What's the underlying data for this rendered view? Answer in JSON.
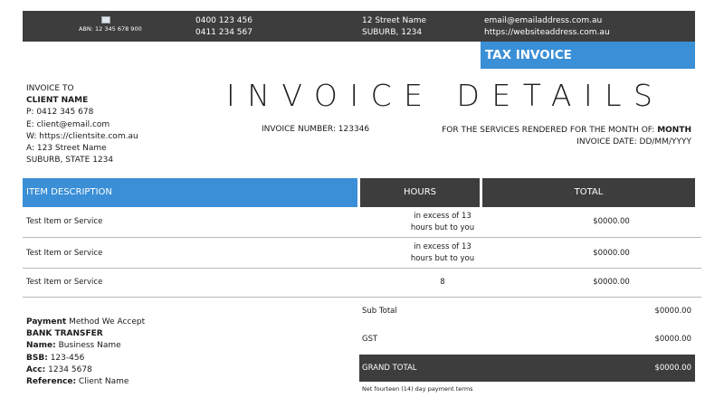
{
  "header": {
    "abn": "ABN: 12 345 678 900",
    "phones": [
      "0400 123 456",
      "0411 234 567"
    ],
    "address": [
      "12 Street Name",
      "SUBURB, 1234"
    ],
    "contact": [
      "email@emailaddress.com.au",
      "https://websiteaddress.com.au"
    ],
    "colors": {
      "dark": "#3d3d3d",
      "accent": "#3a8fd6"
    }
  },
  "badge": "TAX INVOICE",
  "client": {
    "heading": "INVOICE TO",
    "name": "CLIENT NAME",
    "phone": "P: 0412 345 678",
    "email": "E: client@email.com",
    "web": "W: https://clientsite.com.au",
    "address1": "A: 123 Street Name",
    "address2": "SUBURB, STATE 1234"
  },
  "title": "INVOICE DETAILS",
  "invoice_number": "INVOICE NUMBER: 123346",
  "services": {
    "prefix": "FOR THE SERVICES RENDERED FOR THE MONTH OF:",
    "month": "MONTH",
    "date": "INVOICE DATE: DD/MM/YYYY"
  },
  "table": {
    "headers": {
      "desc": "ITEM DESCRIPTION",
      "hours": "HOURS",
      "total": "TOTAL"
    },
    "rows": [
      {
        "desc": "Test Item or Service",
        "hours_line1": "in excess of 13",
        "hours_line2": "hours but to you",
        "total": "$0000.00"
      },
      {
        "desc": "Test Item or Service",
        "hours_line1": "in excess of 13",
        "hours_line2": "hours but to you",
        "total": "$0000.00"
      },
      {
        "desc": "Test Item or Service",
        "hours_line1": "8",
        "hours_line2": "",
        "total": "$0000.00"
      }
    ]
  },
  "payment": {
    "label_bold": "Payment",
    "label_rest": "Method We Accept",
    "method": "BANK TRANSFER",
    "name_label": "Name:",
    "name": "Business Name",
    "bsb_label": "BSB:",
    "bsb": "123-456",
    "acc_label": "Acc:",
    "acc": "1234 5678",
    "ref_label": "Reference:",
    "ref": "Client Name"
  },
  "summary": {
    "subtotal_label": "Sub Total",
    "subtotal": "$0000.00",
    "gst_label": "GST",
    "gst": "$0000.00",
    "grand_label": "GRAND TOTAL",
    "grand": "$0000.00",
    "terms": "Net fourteen (14) day payment terms"
  }
}
